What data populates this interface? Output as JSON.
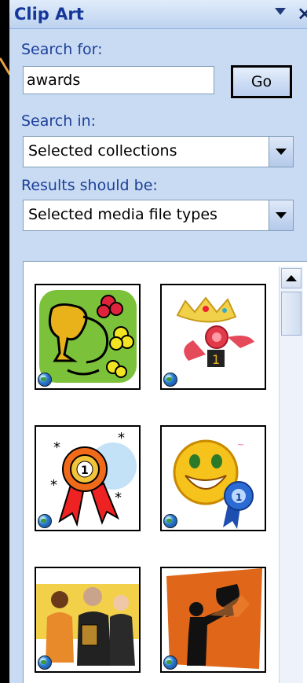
{
  "pane": {
    "title": "Clip Art",
    "close_label": "×"
  },
  "search": {
    "label": "Search for:",
    "value": "awards",
    "go_label": "Go"
  },
  "search_in": {
    "label": "Search in:",
    "value": "Selected collections"
  },
  "results_type": {
    "label": "Results should be:",
    "value": "Selected media file types"
  },
  "clips": [
    {
      "name": "trophy-clip-1",
      "icon": "trophy-flowers"
    },
    {
      "name": "crown-ribbon-clip",
      "icon": "crown-ribbon-first"
    },
    {
      "name": "first-place-rosette-clip",
      "icon": "rosette-1"
    },
    {
      "name": "smiley-ribbon-clip",
      "icon": "smiley-blue-ribbon"
    },
    {
      "name": "people-award-clip",
      "icon": "people-presenting-award"
    },
    {
      "name": "trophy-silhouette-clip",
      "icon": "silhouette-raising-trophy"
    }
  ],
  "colors": {
    "pane_bg": "#c8dbf2",
    "title_text": "#16379a",
    "label_text": "#1d3f9a",
    "callout_line": "#e8a040"
  }
}
